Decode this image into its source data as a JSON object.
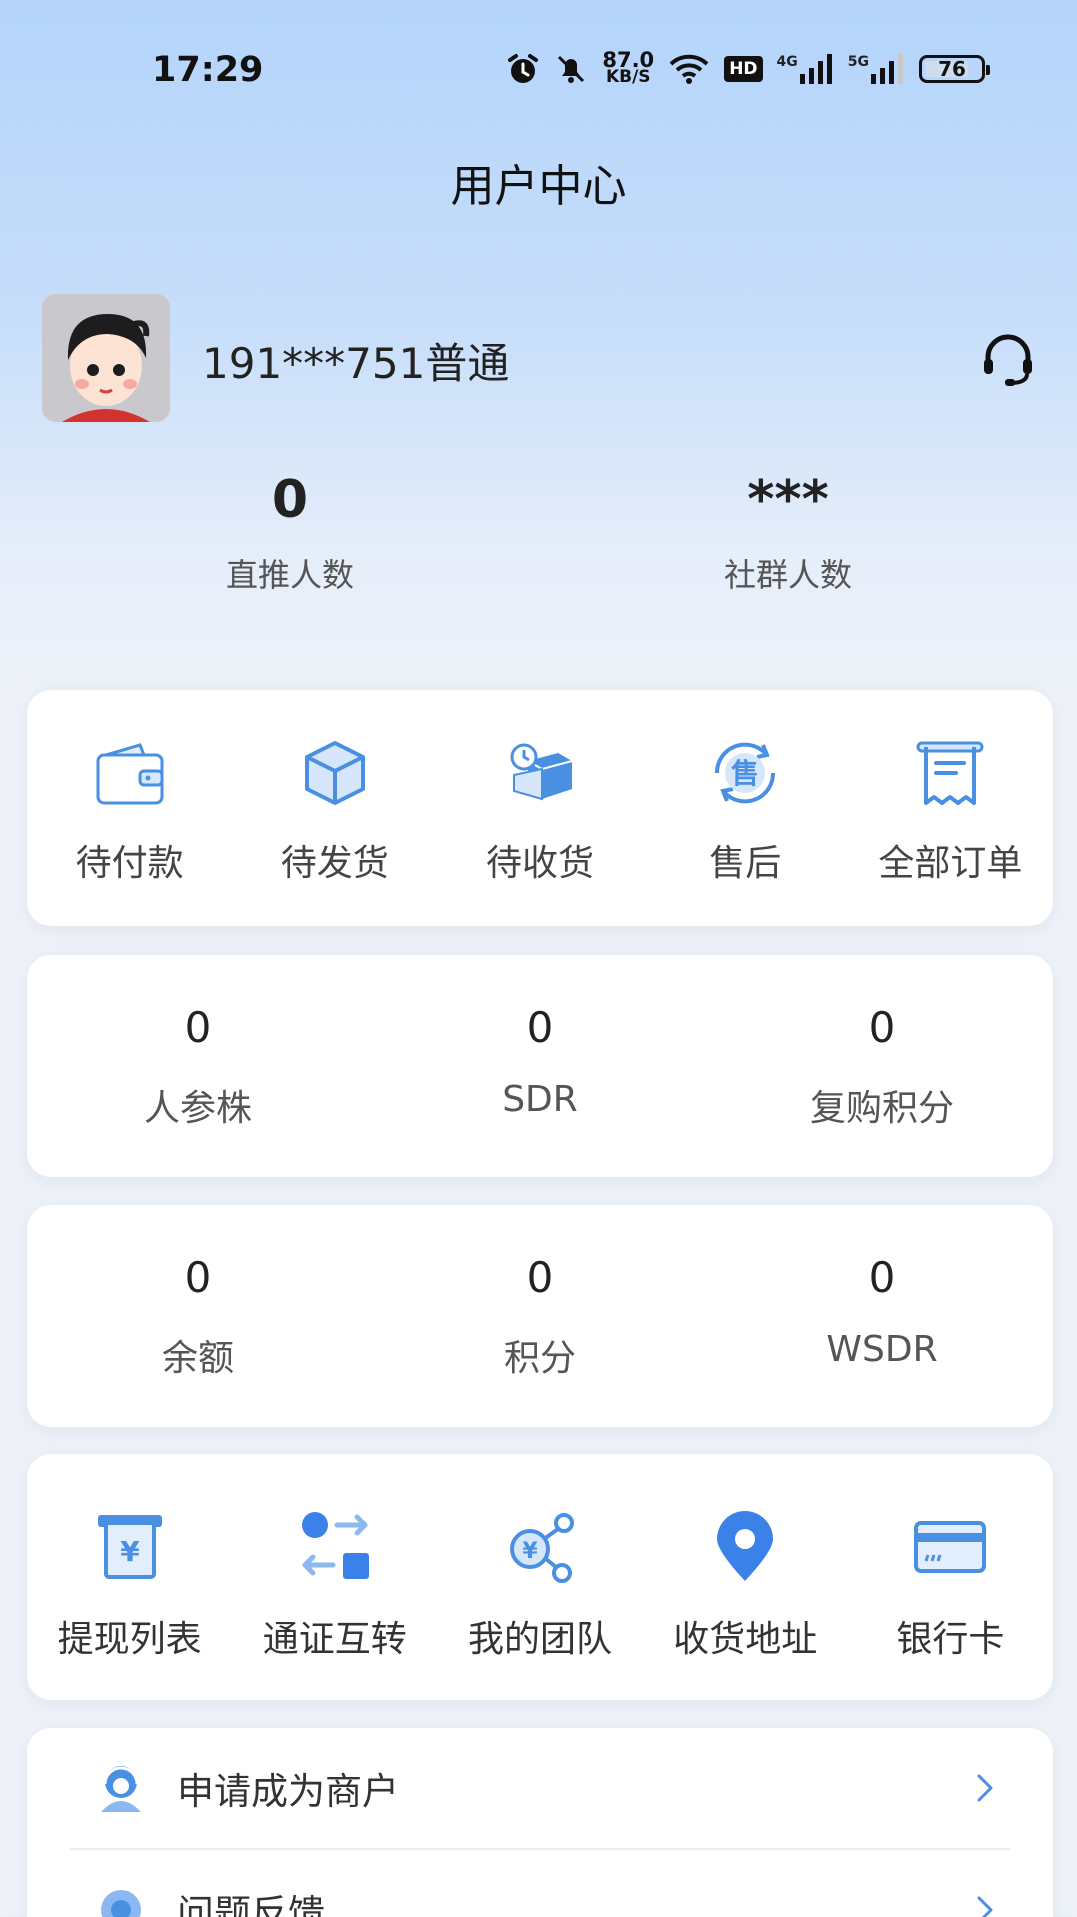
{
  "status_bar": {
    "time": "17:29",
    "net_speed_value": "87.0",
    "net_speed_unit": "KB/S",
    "hd_label": "HD",
    "sim1_label": "4G",
    "sim2_label": "5G",
    "battery": "76",
    "icons": [
      "alarm-icon",
      "mute-icon",
      "wifi-icon",
      "hd-icon",
      "signal-4g-icon",
      "signal-5g-icon",
      "battery-icon"
    ]
  },
  "header": {
    "title": "用户中心"
  },
  "profile": {
    "username": "191***751普通",
    "support_icon": "headset-icon"
  },
  "summary": [
    {
      "value": "0",
      "label": "直推人数"
    },
    {
      "value": "***",
      "label": "社群人数"
    }
  ],
  "orders": [
    {
      "label": "待付款",
      "icon": "wallet-icon"
    },
    {
      "label": "待发货",
      "icon": "box-icon"
    },
    {
      "label": "待收货",
      "icon": "delivery-box-icon"
    },
    {
      "label": "售后",
      "icon": "after-sales-icon"
    },
    {
      "label": "全部订单",
      "icon": "receipt-icon"
    }
  ],
  "assets_row1": [
    {
      "value": "0",
      "label": "人参株"
    },
    {
      "value": "0",
      "label": "SDR"
    },
    {
      "value": "0",
      "label": "复购积分"
    }
  ],
  "assets_row2": [
    {
      "value": "0",
      "label": "余额"
    },
    {
      "value": "0",
      "label": "积分"
    },
    {
      "value": "0",
      "label": "WSDR"
    }
  ],
  "tools": [
    {
      "label": "提现列表",
      "icon": "withdraw-icon"
    },
    {
      "label": "通证互转",
      "icon": "transfer-icon"
    },
    {
      "label": "我的团队",
      "icon": "team-icon"
    },
    {
      "label": "收货地址",
      "icon": "location-pin-icon"
    },
    {
      "label": "银行卡",
      "icon": "bank-card-icon"
    }
  ],
  "menu": [
    {
      "label": "申请成为商户",
      "icon": "merchant-icon"
    },
    {
      "label": "问题反馈",
      "icon": "feedback-icon"
    }
  ],
  "colors": {
    "accent": "#4a90e2",
    "background_top": "#b4d4fb",
    "card": "#ffffff"
  }
}
